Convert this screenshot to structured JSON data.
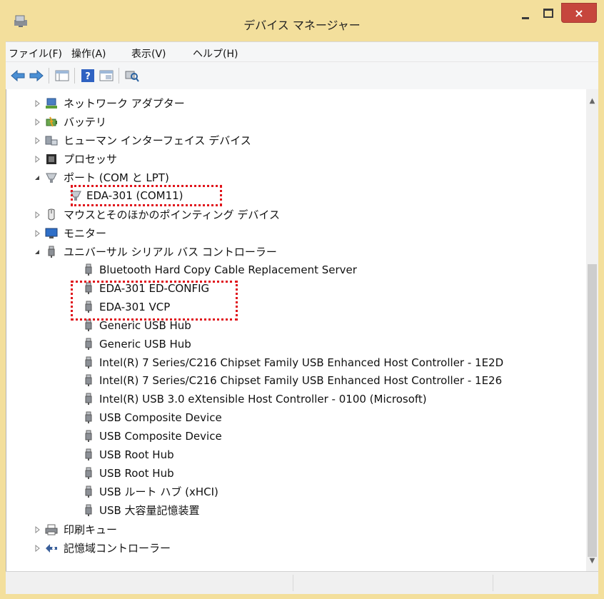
{
  "window": {
    "title": "デバイス マネージャー",
    "close_label": "×"
  },
  "menu": [
    "ファイル(F)",
    "操作(A)",
    "表示(V)",
    "ヘルプ(H)"
  ],
  "tree": {
    "categories": [
      {
        "label": "ネットワーク アダプター",
        "icon": "network-adapter-icon",
        "expanded": false
      },
      {
        "label": "バッテリ",
        "icon": "battery-icon",
        "expanded": false
      },
      {
        "label": "ヒューマン インターフェイス デバイス",
        "icon": "hid-icon",
        "expanded": false
      },
      {
        "label": "プロセッサ",
        "icon": "processor-icon",
        "expanded": false
      },
      {
        "label": "ポート (COM と LPT)",
        "icon": "port-icon",
        "expanded": true,
        "children": [
          "EDA-301 (COM11)"
        ]
      },
      {
        "label": "マウスとそのほかのポインティング デバイス",
        "icon": "mouse-icon",
        "expanded": false
      },
      {
        "label": "モニター",
        "icon": "monitor-icon",
        "expanded": false
      },
      {
        "label": "ユニバーサル シリアル バス コントローラー",
        "icon": "usb-icon",
        "expanded": true,
        "children": [
          "Bluetooth Hard Copy Cable Replacement Server",
          "EDA-301 ED-CONFIG",
          "EDA-301 VCP",
          "Generic USB Hub",
          "Generic USB Hub",
          "Intel(R) 7 Series/C216 Chipset Family USB Enhanced Host Controller - 1E2D",
          "Intel(R) 7 Series/C216 Chipset Family USB Enhanced Host Controller - 1E26",
          "Intel(R) USB 3.0 eXtensible Host Controller - 0100 (Microsoft)",
          "USB Composite Device",
          "USB Composite Device",
          "USB Root Hub",
          "USB Root Hub",
          "USB ルート ハブ (xHCI)",
          "USB 大容量記憶装置"
        ]
      },
      {
        "label": "印刷キュー",
        "icon": "printer-icon",
        "expanded": false
      },
      {
        "label": "記憶域コントローラー",
        "icon": "storage-controller-icon",
        "expanded": false
      }
    ]
  },
  "highlight_color": "#e0141b"
}
